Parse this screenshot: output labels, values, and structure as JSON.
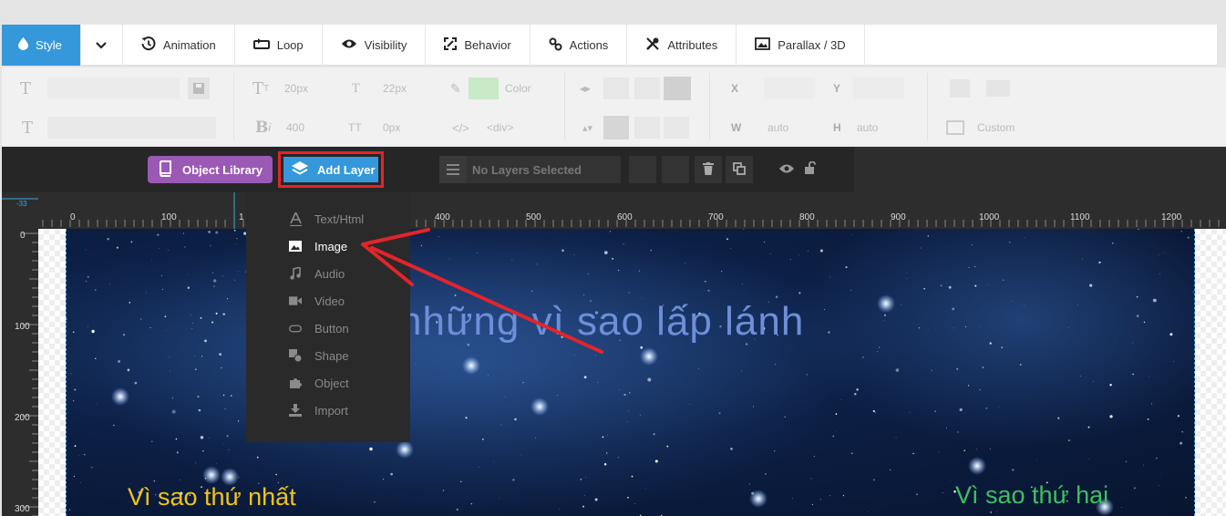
{
  "tabs": [
    {
      "label": "Style",
      "icon": "droplet-icon",
      "active": true
    },
    {
      "label": "",
      "icon": "chevron-down-icon"
    },
    {
      "label": "Animation",
      "icon": "history-icon"
    },
    {
      "label": "Loop",
      "icon": "loop-icon"
    },
    {
      "label": "Visibility",
      "icon": "eye-icon"
    },
    {
      "label": "Behavior",
      "icon": "behavior-icon"
    },
    {
      "label": "Actions",
      "icon": "link-icon"
    },
    {
      "label": "Attributes",
      "icon": "wrench-icon"
    },
    {
      "label": "Parallax / 3D",
      "icon": "image-icon"
    }
  ],
  "props": {
    "font_size": "20px",
    "line_height": "22px",
    "color_label": "Color",
    "font_weight": "400",
    "letter_spacing": "0px",
    "tag": "<div>",
    "x_label": "X",
    "y_label": "Y",
    "w_label": "W",
    "h_label": "H",
    "w_value": "auto",
    "h_value": "auto",
    "custom_label": "Custom",
    "color_swatch": "#c9eac7"
  },
  "layer_toolbar": {
    "object_library": "Object Library",
    "add_layer": "Add Layer",
    "no_layers": "No Layers Selected"
  },
  "ruler": {
    "h_labels": [
      "0",
      "100",
      "1",
      "400",
      "500",
      "600",
      "700",
      "800",
      "900",
      "1000",
      "1100",
      "1200"
    ],
    "v_labels": [
      "0",
      "100",
      "200",
      "300"
    ],
    "corner": "-33"
  },
  "add_layer_menu": [
    {
      "label": "Text/Html",
      "icon": "text-icon"
    },
    {
      "label": "Image",
      "icon": "image-icon",
      "highlight": true
    },
    {
      "label": "Audio",
      "icon": "music-icon"
    },
    {
      "label": "Video",
      "icon": "video-icon"
    },
    {
      "label": "Button",
      "icon": "button-icon"
    },
    {
      "label": "Shape",
      "icon": "shape-icon"
    },
    {
      "label": "Object",
      "icon": "puzzle-icon"
    },
    {
      "label": "Import",
      "icon": "import-icon"
    }
  ],
  "canvas": {
    "headline": "những vì sao lấp lánh",
    "caption_left": "Vì sao thứ nhất",
    "caption_right": "Vì sao thứ hai"
  },
  "colors": {
    "accent": "#3498db",
    "library": "#9b59b6",
    "highlight_frame": "#e3242b",
    "headline": "#6d8ed8",
    "caption_left": "#f0c419",
    "caption_right": "#3fbf63"
  }
}
